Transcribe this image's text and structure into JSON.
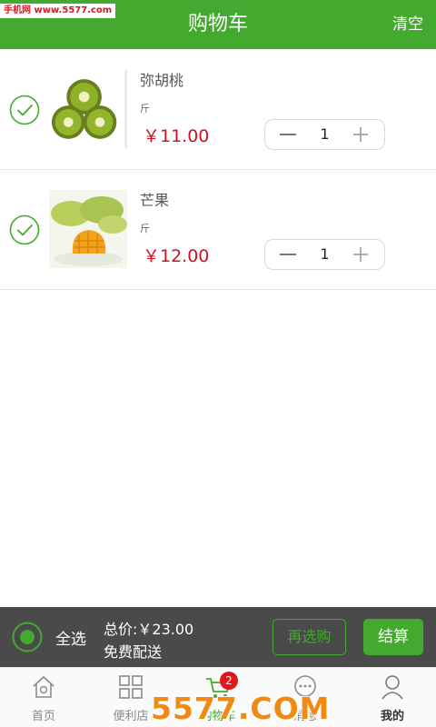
{
  "watermark": "手机网 www.5577.com",
  "header": {
    "title": "购物车",
    "clear_label": "清空"
  },
  "colors": {
    "brand_green": "#44a92f",
    "price_red": "#c9151e",
    "bar_dark": "#4a4a4a"
  },
  "cart": {
    "items": [
      {
        "name": "弥胡桃",
        "unit": "斤",
        "price": "￥11.00",
        "quantity": "1",
        "selected": true,
        "image": "kiwi-image"
      },
      {
        "name": "芒果",
        "unit": "斤",
        "price": "￥12.00",
        "quantity": "1",
        "selected": true,
        "image": "mango-image"
      }
    ]
  },
  "summary": {
    "select_all_label": "全选",
    "total": "总价:￥23.00",
    "shipping": "免费配送",
    "rebuy_label": "再选购",
    "checkout_label": "结算"
  },
  "tabbar": {
    "tabs": [
      {
        "label": "首页",
        "icon": "home-icon"
      },
      {
        "label": "便利店",
        "icon": "grid-icon"
      },
      {
        "label": "购物车",
        "icon": "cart-icon",
        "badge": "2"
      },
      {
        "label": "消息",
        "icon": "chat-icon"
      },
      {
        "label": "我的",
        "icon": "user-icon"
      }
    ]
  },
  "footer_watermark": "5577.COM"
}
